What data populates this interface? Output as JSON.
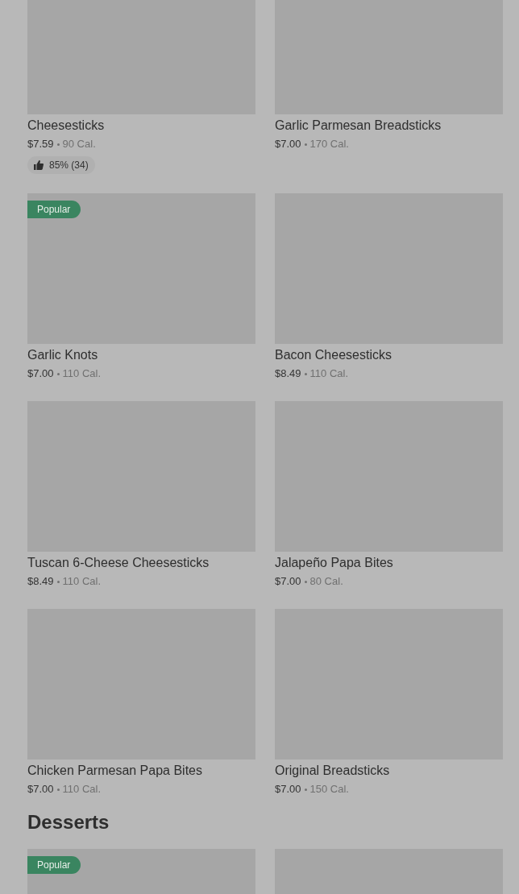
{
  "sections": [
    {
      "items": [
        {
          "kind": "dish",
          "name": "Cheesesticks",
          "price": "$7.59",
          "calories": "90 Cal.",
          "rating": "85% (34)"
        },
        {
          "kind": "dish",
          "name": "Garlic Parmesan Breadsticks",
          "price": "$7.00",
          "calories": "170 Cal."
        },
        {
          "kind": "dish",
          "name": "Garlic Knots",
          "price": "$7.00",
          "calories": "110 Cal.",
          "badge": "Popular"
        },
        {
          "kind": "dish",
          "name": "Bacon Cheesesticks",
          "price": "$8.49",
          "calories": "110 Cal."
        },
        {
          "kind": "dish",
          "name": "Tuscan 6-Cheese Cheesesticks",
          "price": "$8.49",
          "calories": "110 Cal."
        },
        {
          "kind": "dish",
          "name": "Jalapeño Papa Bites",
          "price": "$7.00",
          "calories": "80 Cal."
        },
        {
          "kind": "dish",
          "name": "Chicken Parmesan Papa Bites",
          "price": "$7.00",
          "calories": "110 Cal."
        },
        {
          "kind": "dish",
          "name": "Original Breadsticks",
          "price": "$7.00",
          "calories": "150 Cal."
        }
      ]
    },
    {
      "title": "Desserts",
      "items": [
        {
          "kind": "dish",
          "badge": "Popular"
        },
        {
          "kind": "dish"
        }
      ]
    }
  ]
}
